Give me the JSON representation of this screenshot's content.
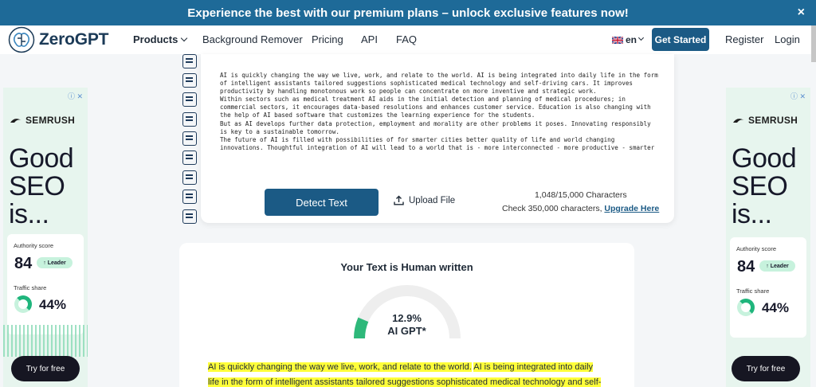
{
  "promo": {
    "text": "Experience the best with our premium plans – unlock exclusive features now!",
    "close": "×"
  },
  "nav": {
    "logo": "ZeroGPT",
    "products": "Products",
    "background_remover": "Background Remover",
    "pricing": "Pricing",
    "api": "API",
    "faq": "FAQ",
    "language": "en",
    "get_started": "Get Started",
    "register": "Register",
    "login": "Login"
  },
  "ads": {
    "info": "ⓘ ✕",
    "brand": "SEMRUSH",
    "headline": "Good SEO is...",
    "authority_label": "Authority score",
    "authority_value": "84",
    "leader_badge": "↑ Leader",
    "traffic_label": "Traffic share",
    "traffic_value": "44%",
    "cta": "Try for free"
  },
  "editor": {
    "text": "AI is quickly changing the way we live, work, and relate to the world. AI is being integrated into daily life in the form of intelligent assistants tailored suggestions sophisticated medical technology and self-driving cars. It improves productivity by handling monotonous work so people can concentrate on more inventive and strategic work.\nWithin sectors such as medical treatment AI aids in the initial detection and planning of medical procedures; in commercial sectors, it encourages data-based resolutions and enhances customer service. Education is also changing with the help of AI based software that customizes the learning experience for the students.\nBut as AI develops further data protection, employment and morality are other problems it poses. Innovating responsibly is key to a sustainable tomorrow.\nThe future of AI is filled with possibilities of for smarter cities better quality of life and world changing innovations. Thoughtful integration of AI will lead to a world that is - more interconnected - more productive - smarter",
    "detect_button": "Detect Text",
    "upload_button": "Upload File",
    "char_count": "1,048/15,000 Characters",
    "check_text": "Check 350,000 characters,",
    "upgrade_link": "Upgrade Here"
  },
  "result": {
    "title": "Your Text is Human written",
    "ai_percent": 12.9,
    "ai_percent_label": "12.9%",
    "ai_label": "AI GPT*",
    "sentence_1": "AI is quickly changing the way we live, work, and relate to the world.",
    "sentence_2": "AI is being integrated into daily life in the form of intelligent assistants tailored suggestions sophisticated medical technology and self-"
  },
  "colors": {
    "brand": "#1b5a85",
    "promo": "#1e6a98",
    "highlight": "#ffff3a",
    "gauge_fill": "#2eb87a",
    "gauge_track": "#eeeeee"
  }
}
